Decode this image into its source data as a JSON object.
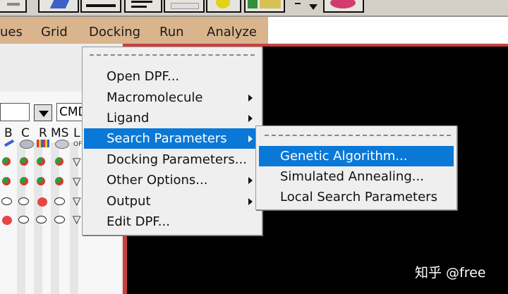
{
  "menubar": {
    "items": [
      "ues",
      "Grid",
      "Docking",
      "Run",
      "Analyze"
    ]
  },
  "left_panel": {
    "cmd_field": "CMD",
    "column_headers": [
      "B",
      "C",
      "R",
      "MS",
      "L"
    ],
    "icon_label": "OF"
  },
  "dropdown": {
    "items": [
      {
        "label": "Open DPF...",
        "has_submenu": false
      },
      {
        "label": "Macromolecule",
        "has_submenu": true
      },
      {
        "label": "Ligand",
        "has_submenu": true
      },
      {
        "label": "Search Parameters",
        "has_submenu": true,
        "highlighted": true
      },
      {
        "label": "Docking Parameters...",
        "has_submenu": false
      },
      {
        "label": "Other Options...",
        "has_submenu": true
      },
      {
        "label": "Output",
        "has_submenu": true
      },
      {
        "label": "Edit DPF...",
        "has_submenu": false
      }
    ]
  },
  "submenu": {
    "items": [
      {
        "label": "Genetic Algorithm...",
        "highlighted": true
      },
      {
        "label": "Simulated Annealing...",
        "highlighted": false
      },
      {
        "label": "Local Search Parameters",
        "highlighted": false
      }
    ]
  },
  "watermark": "知乎 @free",
  "colors": {
    "menubar_bg": "#d9b48c",
    "highlight": "#0a78d7",
    "viewer_bg": "#000000",
    "menu_bg": "#efefef"
  }
}
